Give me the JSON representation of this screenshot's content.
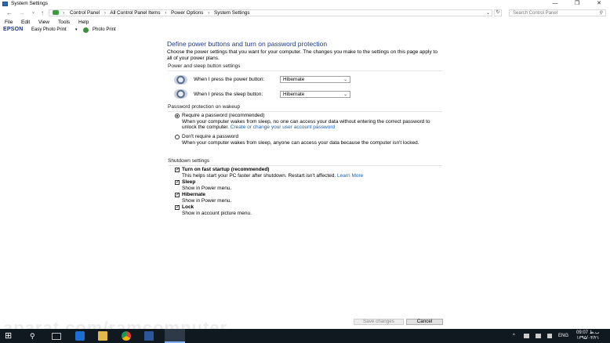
{
  "window": {
    "title": "System Settings",
    "controls": {
      "minimize": "—",
      "maximize": "❐",
      "close": "✕"
    }
  },
  "addressbar": {
    "back": "←",
    "forward": "→",
    "recent": "⌄",
    "up": "↑",
    "breadcrumbs": [
      "Control Panel",
      "All Control Panel Items",
      "Power Options",
      "System Settings"
    ],
    "separator": "›",
    "dropdown": "⌄",
    "refresh": "↻",
    "search_placeholder": "Search Control Panel",
    "search_icon": "⚲"
  },
  "menu": [
    "File",
    "Edit",
    "View",
    "Tools",
    "Help"
  ],
  "epson": {
    "logo": "EPSON",
    "items": [
      "Easy Photo Print",
      "Photo Print"
    ],
    "dropdown": "▾"
  },
  "page": {
    "heading": "Define power buttons and turn on password protection",
    "description": "Choose the power settings that you want for your computer. The changes you make to the settings on this page apply to all of your power plans.",
    "power_section": "Power and sleep button settings",
    "power_button_label": "When I press the power button:",
    "power_button_value": "Hibernate",
    "sleep_button_label": "When I press the sleep button:",
    "sleep_button_value": "Hibernate",
    "password_section": "Password protection on wakeup",
    "require_label": "Require a password (recommended)",
    "require_desc": "When your computer wakes from sleep, no one can access your data without entering the correct password to unlock the computer.",
    "require_link": "Create or change your user account password",
    "no_require_label": "Don't require a password",
    "no_require_desc": "When your computer wakes from sleep, anyone can access your data because the computer isn't locked.",
    "shutdown_section": "Shutdown settings",
    "fast_startup_label": "Turn on fast startup (recommended)",
    "fast_startup_desc": "This helps start your PC faster after shutdown. Restart isn't affected.",
    "learn_more": "Learn More",
    "sleep_label": "Sleep",
    "sleep_desc": "Show in Power menu.",
    "hibernate_label": "Hibernate",
    "hibernate_desc": "Show in Power menu.",
    "lock_label": "Lock",
    "lock_desc": "Show in account picture menu.",
    "check_mark": "✓",
    "select_arrow": "⌄",
    "save_button": "Save changes",
    "cancel_button": "Cancel"
  },
  "taskbar": {
    "start": "⊞",
    "search": "⚲",
    "tray_chevron": "^",
    "language": "ENG",
    "time": "09:07 ب.ظ",
    "date": "۱۳۹۵/۰۳/۲۱"
  },
  "watermark": "aparat.com/ramcomputer",
  "colors": {
    "heading": "#1e3a8a",
    "link": "#1a5fb4",
    "taskbar": "#101820"
  }
}
